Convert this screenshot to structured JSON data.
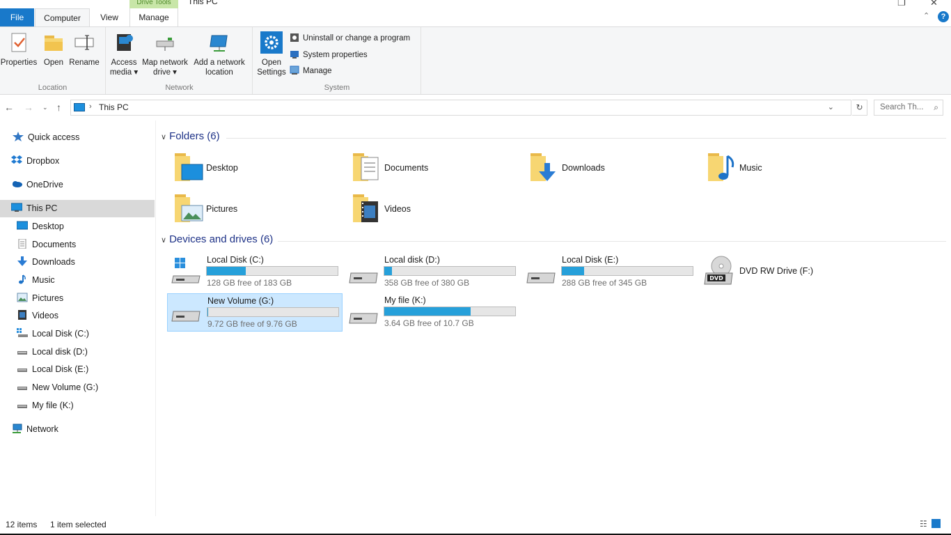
{
  "window": {
    "title": "This PC",
    "context_tab_label": "Drive Tools"
  },
  "tabs": {
    "file": "File",
    "computer": "Computer",
    "view": "View",
    "manage": "Manage"
  },
  "ribbon": {
    "location": {
      "label": "Location",
      "properties": "Properties",
      "open": "Open",
      "rename": "Rename"
    },
    "network": {
      "label": "Network",
      "access_media_1": "Access",
      "access_media_2": "media ▾",
      "map_drive_1": "Map network",
      "map_drive_2": "drive ▾",
      "add_location_1": "Add a network",
      "add_location_2": "location"
    },
    "system": {
      "label": "System",
      "open_settings_1": "Open",
      "open_settings_2": "Settings",
      "uninstall": "Uninstall or change a program",
      "system_properties": "System properties",
      "manage": "Manage"
    }
  },
  "address": {
    "crumb": "This PC",
    "search_placeholder": "Search Th..."
  },
  "nav": {
    "quick_access": "Quick access",
    "dropbox": "Dropbox",
    "onedrive": "OneDrive",
    "this_pc": "This PC",
    "desktop": "Desktop",
    "documents": "Documents",
    "downloads": "Downloads",
    "music": "Music",
    "pictures": "Pictures",
    "videos": "Videos",
    "disk_c": "Local Disk (C:)",
    "disk_d": "Local disk (D:)",
    "disk_e": "Local Disk (E:)",
    "disk_g": "New Volume (G:)",
    "disk_k": "My file (K:)",
    "network": "Network"
  },
  "content": {
    "folders_header": "Folders (6)",
    "drives_header": "Devices and drives (6)",
    "folders": [
      "Desktop",
      "Documents",
      "Downloads",
      "Music",
      "Pictures",
      "Videos"
    ],
    "drives": [
      {
        "name": "Local Disk (C:)",
        "free": "128 GB free of 183 GB",
        "used_fraction": 0.3
      },
      {
        "name": "Local disk (D:)",
        "free": "358 GB free of 380 GB",
        "used_fraction": 0.06
      },
      {
        "name": "Local Disk (E:)",
        "free": "288 GB free of 345 GB",
        "used_fraction": 0.17
      },
      {
        "name": "DVD RW Drive (F:)"
      },
      {
        "name": "New Volume (G:)",
        "free": "9.72 GB free of 9.76 GB",
        "used_fraction": 0.004
      },
      {
        "name": "My file (K:)",
        "free": "3.64 GB free of 10.7 GB",
        "used_fraction": 0.66
      }
    ]
  },
  "status": {
    "items": "12 items",
    "selected": "1 item selected"
  },
  "colors": {
    "accent": "#1979ca",
    "bar_fill": "#26a0da",
    "selection": "#cce8ff",
    "header_blue": "#1e3287"
  }
}
